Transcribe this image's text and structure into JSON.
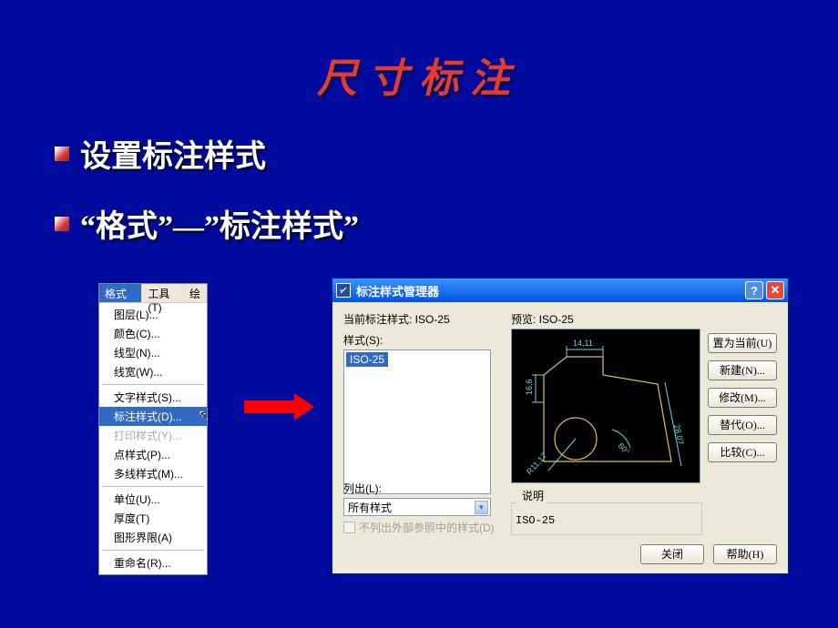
{
  "title": "尺寸标注",
  "bullets": [
    "设置标注样式",
    "“格式”—”标注样式”"
  ],
  "menu": {
    "bar": {
      "format": "格式(O)",
      "tools": "工具(T)",
      "draw": "绘"
    },
    "items": [
      "图层(L)...",
      "颜色(C)...",
      "线型(N)...",
      "线宽(W)...",
      "文字样式(S)...",
      "标注样式(D)...",
      "打印样式(Y)...",
      "点样式(P)...",
      "多线样式(M)...",
      "单位(U)...",
      "厚度(T)",
      "图形界限(A)",
      "重命名(R)..."
    ]
  },
  "dialog": {
    "title": "标注样式管理器",
    "current_label": "当前标注样式: ISO-25",
    "styles_label": "样式(S):",
    "style_item": "ISO-25",
    "preview_label": "预览: ISO-25",
    "buttons": {
      "set_current": "置为当前(U)",
      "new": "新建(N)...",
      "modify": "修改(M)...",
      "override": "替代(O)...",
      "compare": "比较(C)..."
    },
    "list_label": "列出(L):",
    "list_value": "所有样式",
    "ext_ref_chk": "不列出外部参照中的样式(D)",
    "desc_label": "说明",
    "desc_value": "ISO-25",
    "close": "关闭",
    "help": "帮助(H)",
    "preview_dims": {
      "top": "14,11",
      "left": "16,6",
      "right": "28,07",
      "radius": "R11,17",
      "angle": "60°"
    }
  }
}
